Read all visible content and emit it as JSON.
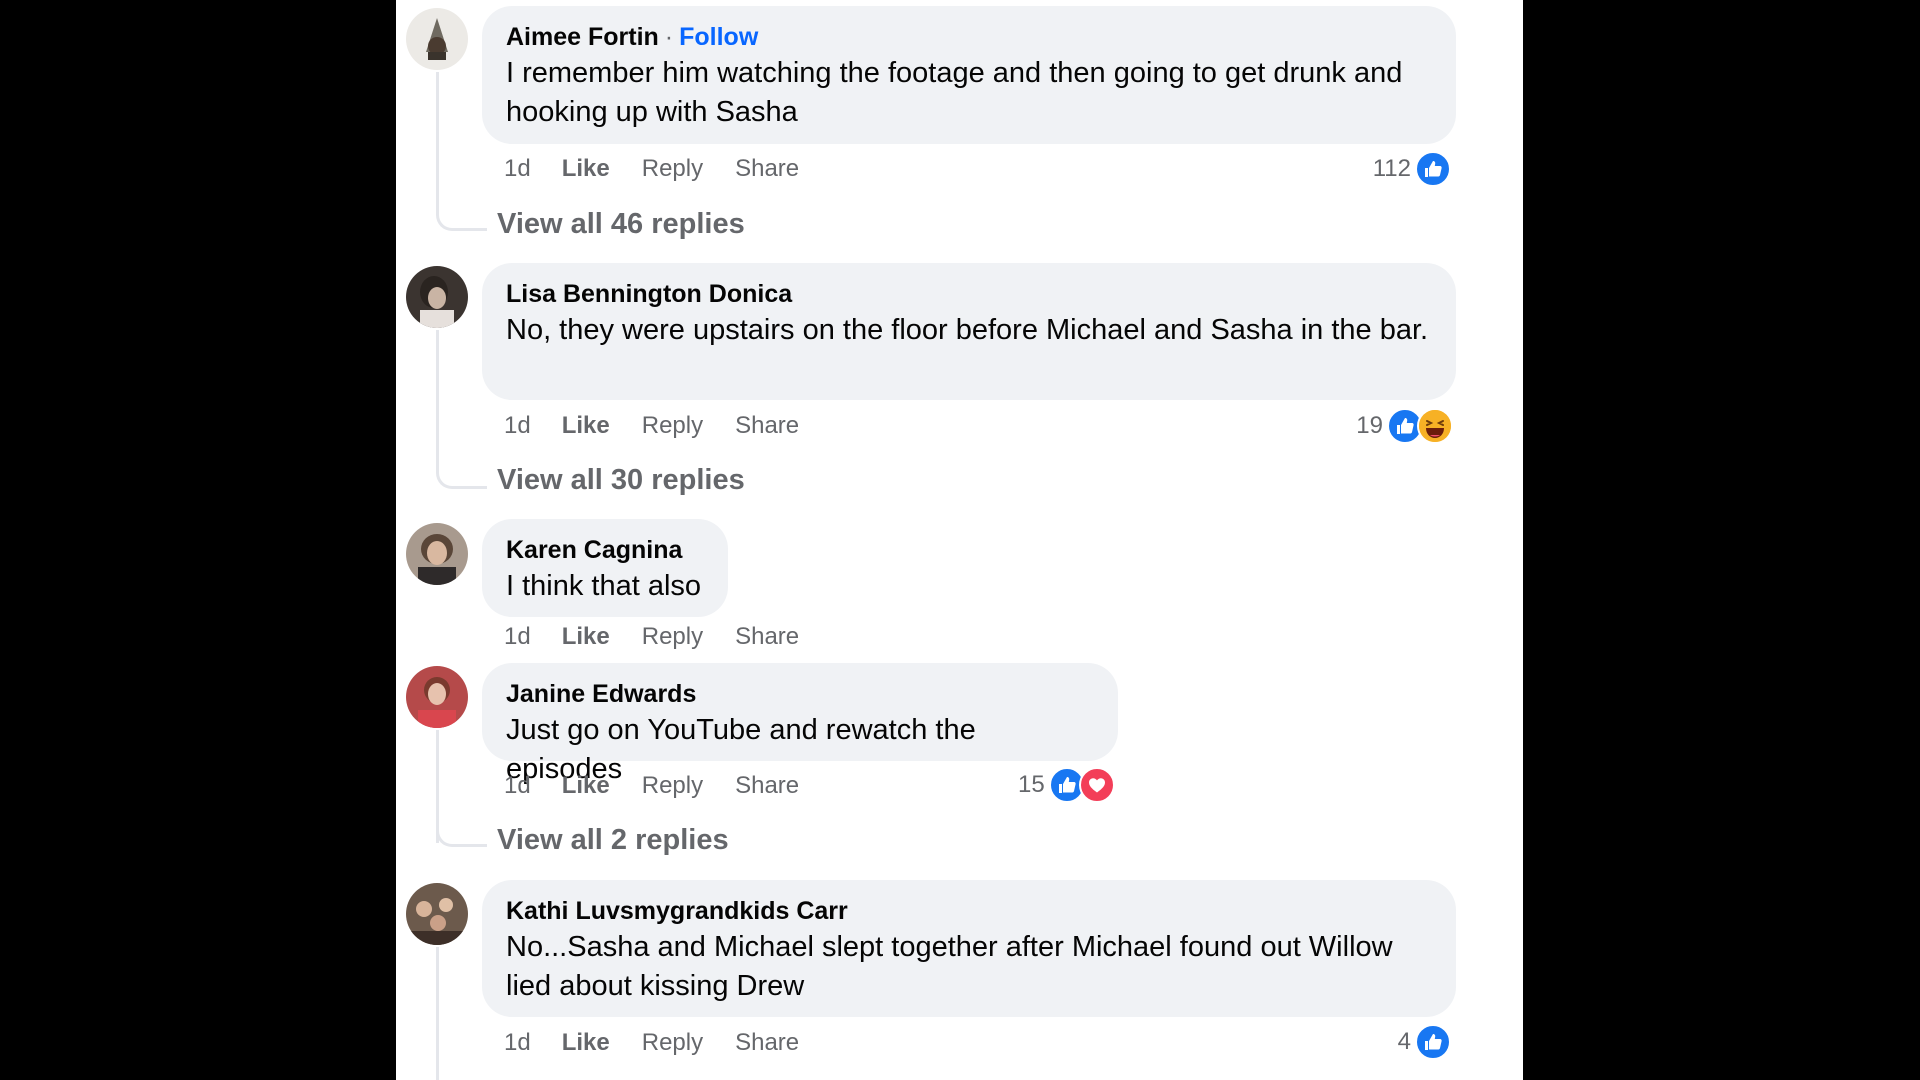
{
  "comments": [
    {
      "author": "Aimee Fortin",
      "follow": "Follow",
      "separator": "·",
      "text": "I remember him watching the footage and then going to get drunk and hooking up with Sasha",
      "time": "1d",
      "like": "Like",
      "reply": "Reply",
      "share": "Share",
      "reaction_count": "112",
      "view_replies": "View all 46 replies"
    },
    {
      "author": "Lisa Bennington Donica",
      "text": "No, they were upstairs on the floor before Michael and Sasha in the bar.",
      "time": "1d",
      "like": "Like",
      "reply": "Reply",
      "share": "Share",
      "reaction_count": "19",
      "view_replies": "View all 30 replies"
    },
    {
      "author": "Karen Cagnina",
      "text": "I think that also",
      "time": "1d",
      "like": "Like",
      "reply": "Reply",
      "share": "Share"
    },
    {
      "author": "Janine Edwards",
      "text": "Just go on YouTube and rewatch the episodes",
      "time": "1d",
      "like": "Like",
      "reply": "Reply",
      "share": "Share",
      "reaction_count": "15",
      "view_replies": "View all 2 replies"
    },
    {
      "author": "Kathi Luvsmygrandkids Carr",
      "text": "No...Sasha and Michael slept together after Michael found out Willow lied about kissing Drew",
      "time": "1d",
      "like": "Like",
      "reply": "Reply",
      "share": "Share",
      "reaction_count": "4"
    }
  ],
  "reaction_icons": [
    "like-icon",
    "love-icon",
    "haha-icon"
  ],
  "colors": {
    "bubble": "#f0f2f5",
    "like_blue": "#1877f2",
    "love_red": "#f33e58",
    "haha_yellow": "#f7b125",
    "follow_blue": "#0866ff",
    "muted_text": "#65676b"
  }
}
